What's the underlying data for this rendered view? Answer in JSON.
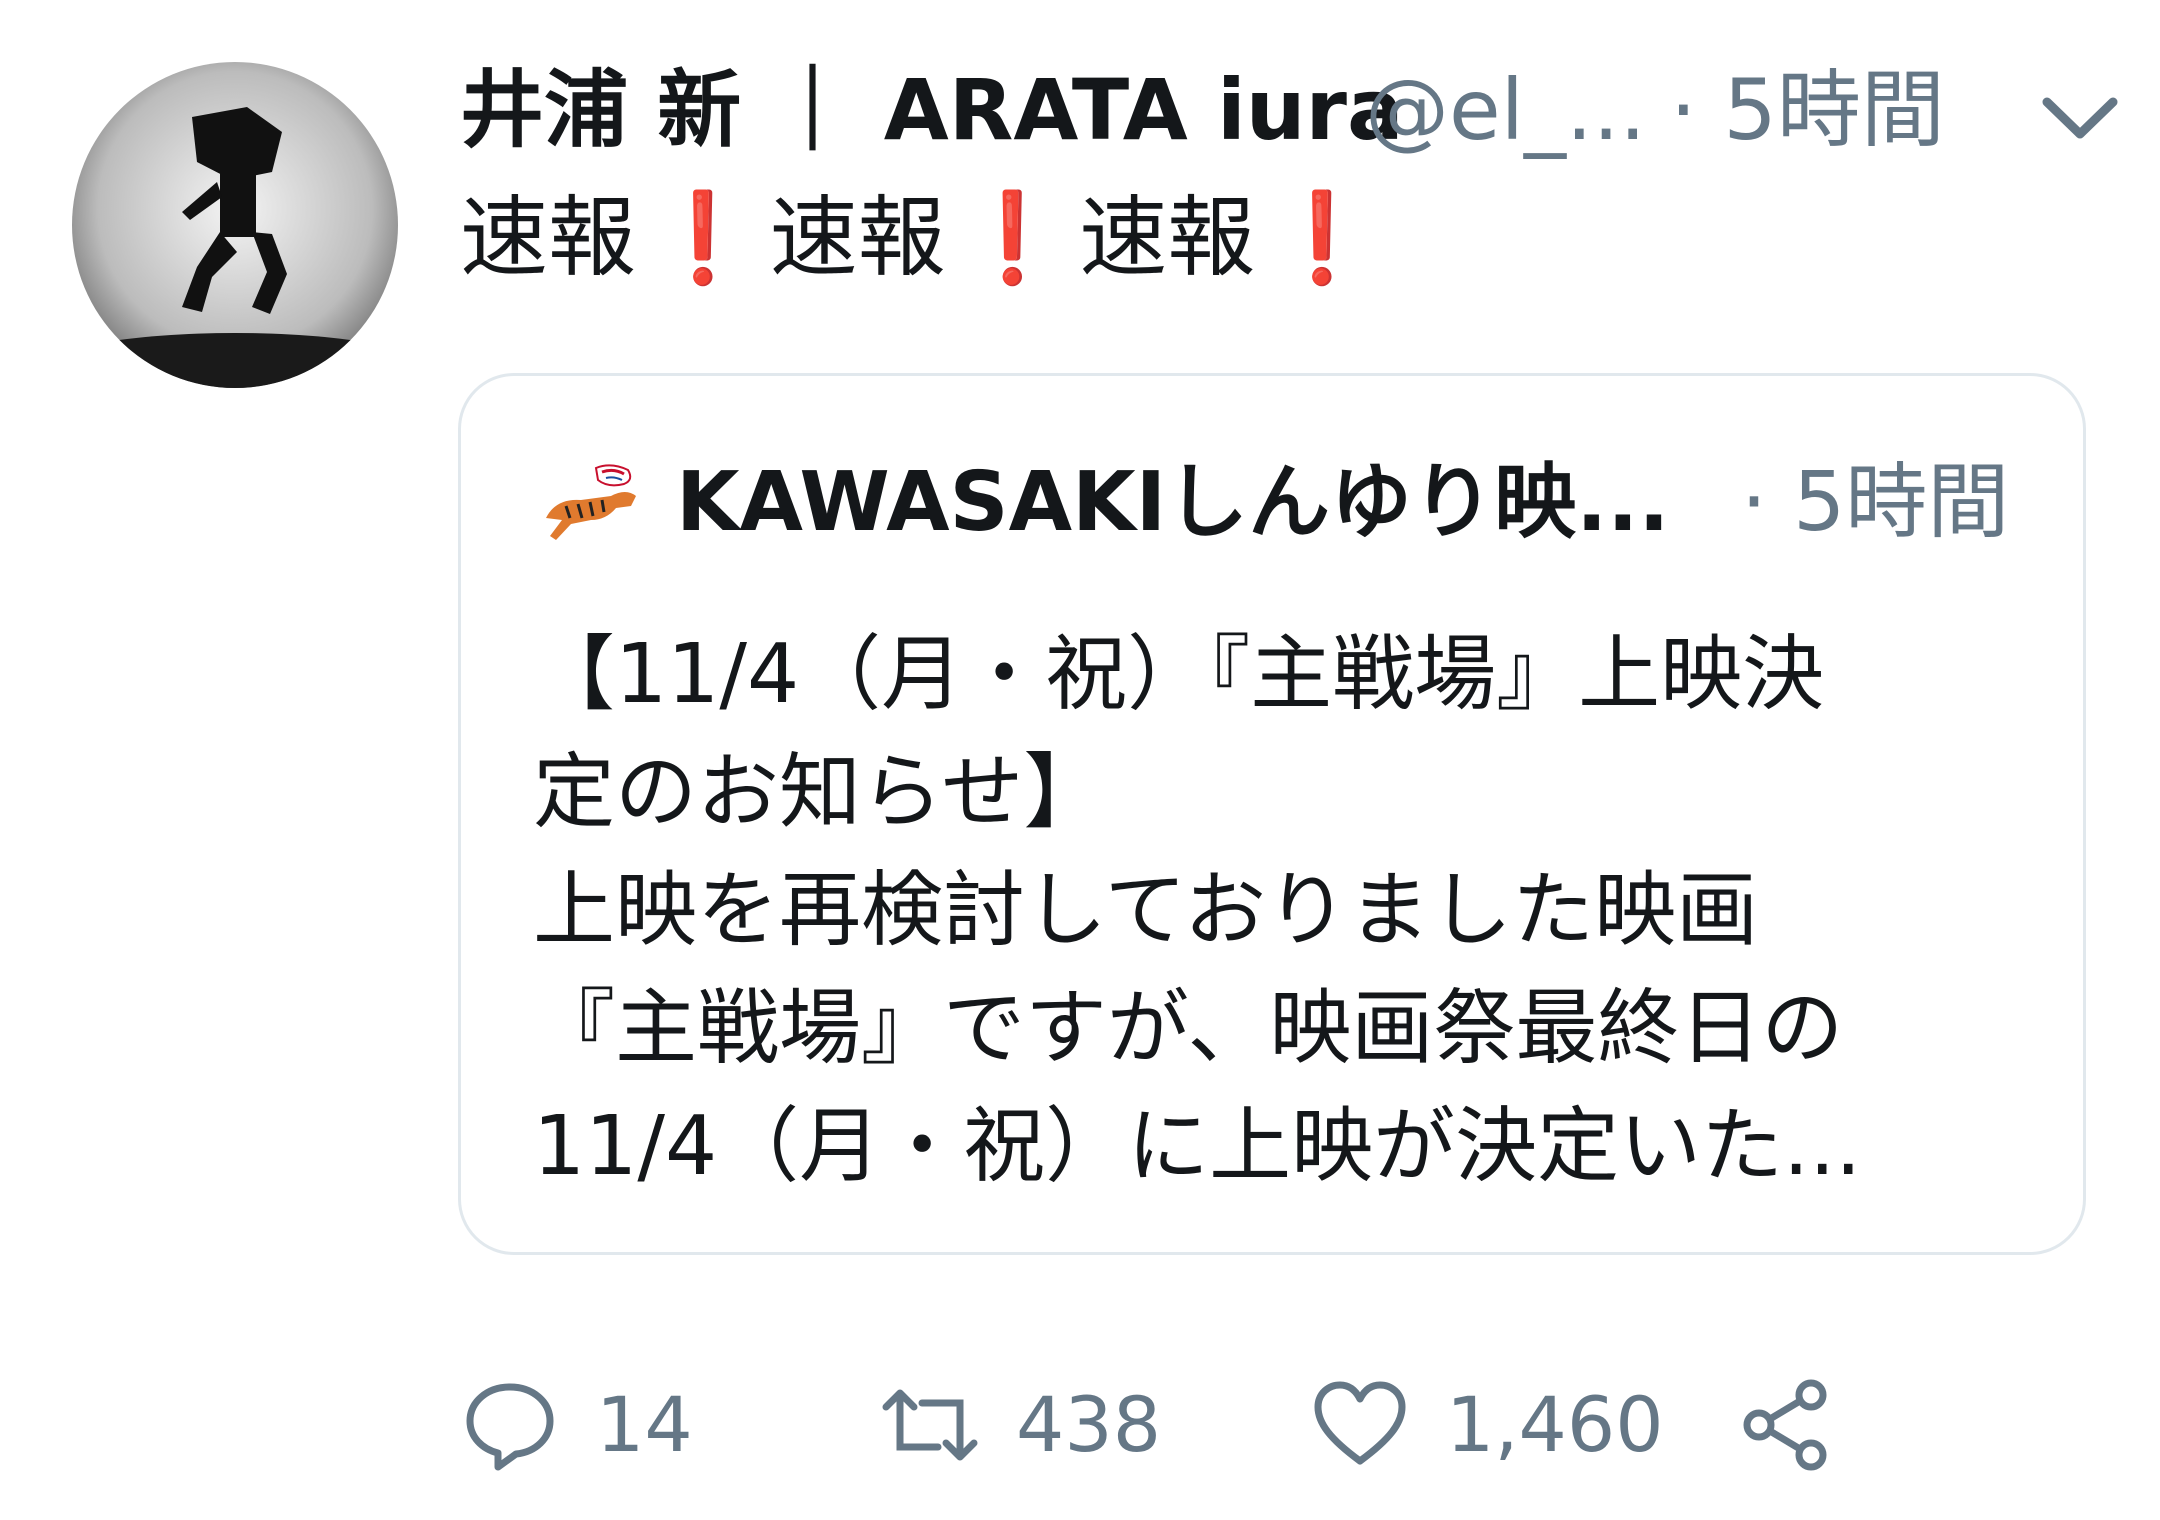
{
  "author": {
    "name": "井浦 新 ｜ ARATA iura",
    "handle": "@el_...",
    "time": "· 5時間"
  },
  "tweet": {
    "segments": [
      "速報",
      "❗",
      "速報",
      "❗",
      "速報",
      "❗"
    ]
  },
  "quoted": {
    "name": "KAWASAKIしんゆり映...",
    "time": "· 5時間",
    "lines": [
      "【11/4（月・祝）『主戦場』上映決",
      "定のお知らせ】",
      "上映を再検討しておりました映画",
      "『主戦場』ですが、映画祭最終日の",
      "11/4（月・祝）に上映が決定いた..."
    ]
  },
  "actions": {
    "reply_count": "14",
    "retweet_count": "438",
    "like_count": "1,460"
  },
  "colors": {
    "text": "#14171a",
    "secondary": "#657786",
    "border": "#e1e8ed",
    "exclamation": "#dd2e44"
  },
  "icons": [
    "chevron-down-icon",
    "reply-icon",
    "retweet-icon",
    "like-icon",
    "share-icon"
  ]
}
